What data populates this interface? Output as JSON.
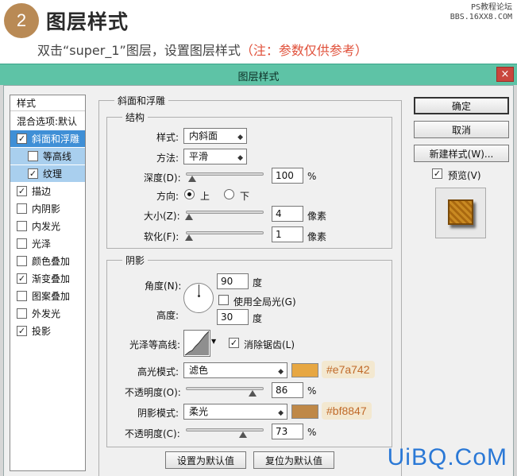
{
  "header": {
    "step": "2",
    "title": "图层样式",
    "watermark_line1": "PS教程论坛",
    "watermark_line2": "BBS.16XX8.COM",
    "instruction": "双击“super_1”图层，设置图层样式",
    "note": "（注：参数仅供参考）"
  },
  "dialog": {
    "title": "图层样式",
    "close": "×"
  },
  "stylelist": {
    "heading": "样式",
    "blend_options": "混合选项:默认",
    "items": [
      {
        "label": "斜面和浮雕",
        "checked": true
      },
      {
        "label": "等高线",
        "checked": false
      },
      {
        "label": "纹理",
        "checked": true
      },
      {
        "label": "描边",
        "checked": true
      },
      {
        "label": "内阴影",
        "checked": false
      },
      {
        "label": "内发光",
        "checked": false
      },
      {
        "label": "光泽",
        "checked": false
      },
      {
        "label": "颜色叠加",
        "checked": false
      },
      {
        "label": "渐变叠加",
        "checked": true
      },
      {
        "label": "图案叠加",
        "checked": false
      },
      {
        "label": "外发光",
        "checked": false
      },
      {
        "label": "投影",
        "checked": true
      }
    ]
  },
  "bevel": {
    "section_title": "斜面和浮雕",
    "structure_title": "结构",
    "style_label": "样式:",
    "style_value": "内斜面",
    "technique_label": "方法:",
    "technique_value": "平滑",
    "depth_label": "深度(D):",
    "depth_value": "100",
    "depth_unit": "%",
    "depth_level": 0.08,
    "direction_label": "方向:",
    "direction_up": "上",
    "direction_down": "下",
    "size_label": "大小(Z):",
    "size_value": "4",
    "size_unit": "像素",
    "soften_label": "软化(F):",
    "soften_value": "1",
    "soften_unit": "像素"
  },
  "shading": {
    "title": "阴影",
    "angle_label": "角度(N):",
    "angle_value": "90",
    "angle_unit": "度",
    "global_light": "使用全局光(G)",
    "altitude_label": "高度:",
    "altitude_value": "30",
    "altitude_unit": "度",
    "gloss_label": "光泽等高线:",
    "antialias": "消除锯齿(L)",
    "highlight_mode_label": "高光模式:",
    "highlight_mode": "滤色",
    "highlight_color": "#e7a742",
    "highlight_hex": "#e7a742",
    "opacity_label": "不透明度(O):",
    "highlight_opacity": "86",
    "highlight_opacity_level": 0.86,
    "shadow_mode_label": "阴影模式:",
    "shadow_mode": "柔光",
    "shadow_color": "#bf8847",
    "shadow_hex": "#bf8847",
    "shadow_opacity_label": "不透明度(C):",
    "shadow_opacity": "73",
    "shadow_opacity_level": 0.73,
    "percent": "%"
  },
  "buttons": {
    "ok": "确定",
    "cancel": "取消",
    "new_style": "新建样式(W)...",
    "preview": "预览(V)",
    "make_default": "设置为默认值",
    "reset_default": "复位为默认值"
  },
  "brand": "UiBQ.CoM"
}
